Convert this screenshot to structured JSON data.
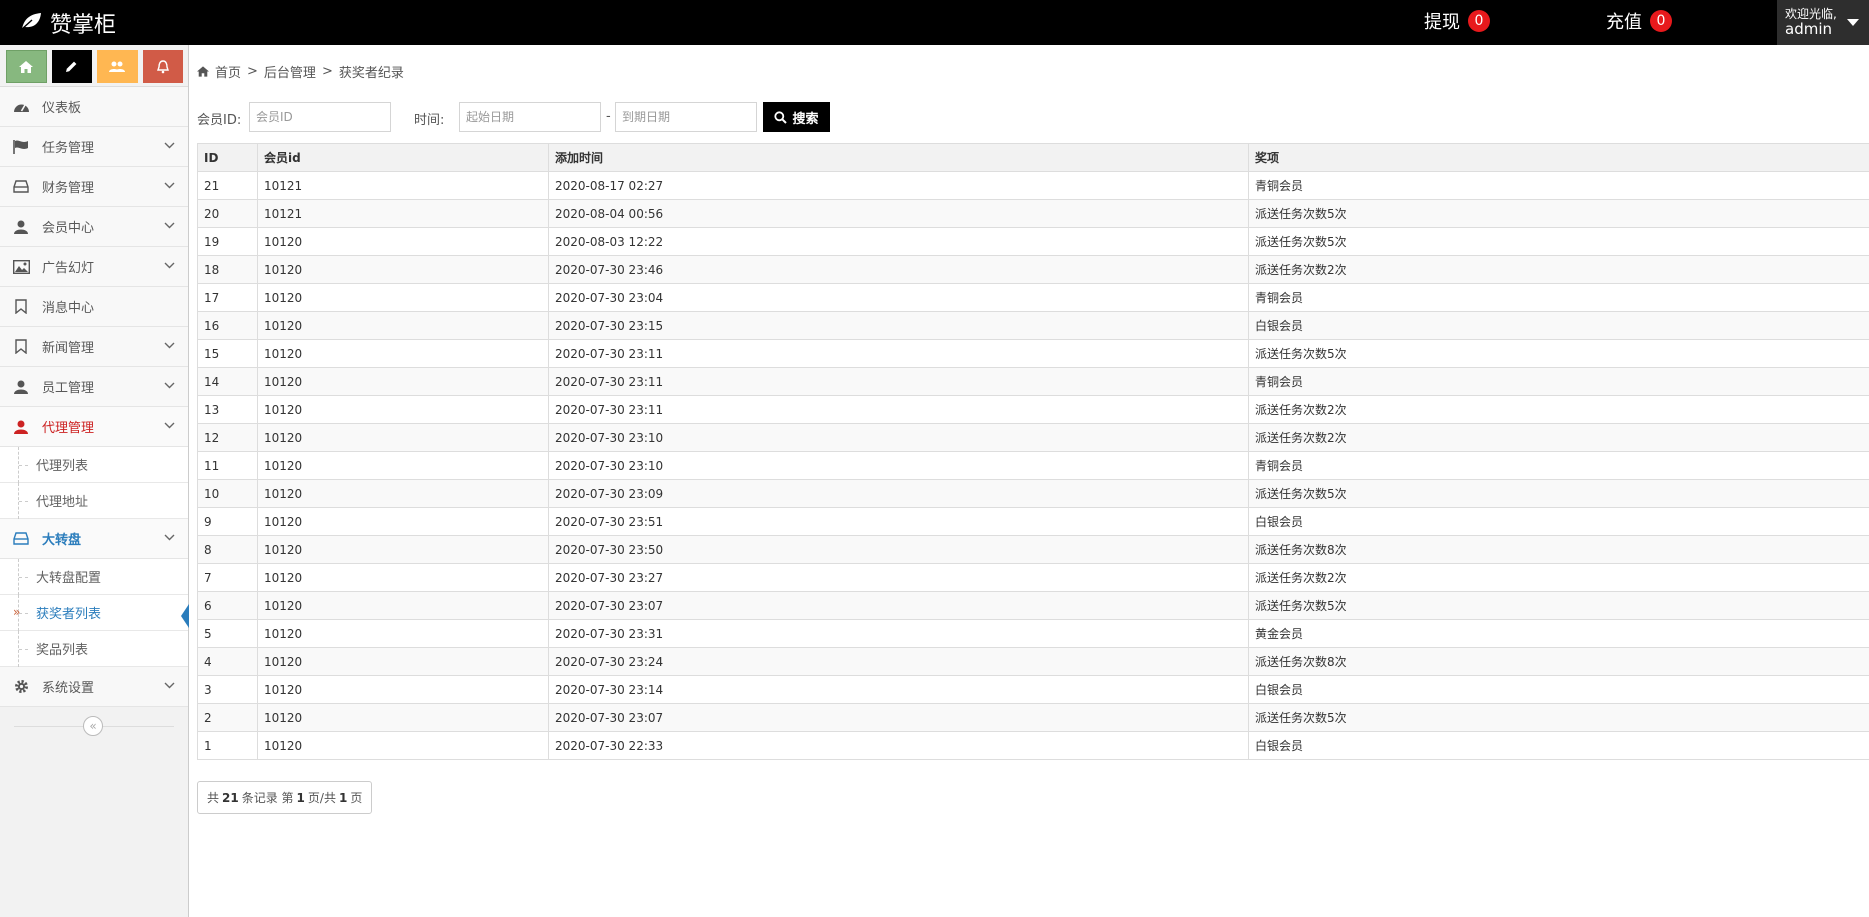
{
  "app": {
    "brand": "赞掌柜"
  },
  "navbar": {
    "withdraw_label": "提现",
    "withdraw_count": "0",
    "recharge_label": "充值",
    "recharge_count": "0",
    "welcome": "欢迎光临,",
    "username": "admin"
  },
  "shortcuts": [
    "home-icon",
    "pencil-icon",
    "users-icon",
    "bell-icon"
  ],
  "sidebar": {
    "dashboard": "仪表板",
    "tasks": "任务管理",
    "finance": "财务管理",
    "members": "会员中心",
    "ads": "广告幻灯",
    "messages": "消息中心",
    "news": "新闻管理",
    "staff": "员工管理",
    "agents": "代理管理",
    "agent_list": "代理列表",
    "agent_address": "代理地址",
    "wheel": "大转盘",
    "wheel_config": "大转盘配置",
    "winner_list": "获奖者列表",
    "prize_list": "奖品列表",
    "settings": "系统设置",
    "collapse": "«"
  },
  "breadcrumb": {
    "home": "首页",
    "sep": ">",
    "admin": "后台管理",
    "current": "获奖者纪录"
  },
  "search": {
    "member_label": "会员ID:",
    "member_placeholder": "会员ID",
    "time_label": "时间:",
    "start_placeholder": "起始日期",
    "dash": "-",
    "end_placeholder": "到期日期",
    "button": "搜索"
  },
  "table": {
    "headers": [
      "ID",
      "会员id",
      "添加时间",
      "奖项"
    ],
    "rows": [
      [
        "21",
        "10121",
        "2020-08-17 02:27",
        "青铜会员"
      ],
      [
        "20",
        "10121",
        "2020-08-04 00:56",
        "派送任务次数5次"
      ],
      [
        "19",
        "10120",
        "2020-08-03 12:22",
        "派送任务次数5次"
      ],
      [
        "18",
        "10120",
        "2020-07-30 23:46",
        "派送任务次数2次"
      ],
      [
        "17",
        "10120",
        "2020-07-30 23:04",
        "青铜会员"
      ],
      [
        "16",
        "10120",
        "2020-07-30 23:15",
        "白银会员"
      ],
      [
        "15",
        "10120",
        "2020-07-30 23:11",
        "派送任务次数5次"
      ],
      [
        "14",
        "10120",
        "2020-07-30 23:11",
        "青铜会员"
      ],
      [
        "13",
        "10120",
        "2020-07-30 23:11",
        "派送任务次数2次"
      ],
      [
        "12",
        "10120",
        "2020-07-30 23:10",
        "派送任务次数2次"
      ],
      [
        "11",
        "10120",
        "2020-07-30 23:10",
        "青铜会员"
      ],
      [
        "10",
        "10120",
        "2020-07-30 23:09",
        "派送任务次数5次"
      ],
      [
        "9",
        "10120",
        "2020-07-30 23:51",
        "白银会员"
      ],
      [
        "8",
        "10120",
        "2020-07-30 23:50",
        "派送任务次数8次"
      ],
      [
        "7",
        "10120",
        "2020-07-30 23:27",
        "派送任务次数2次"
      ],
      [
        "6",
        "10120",
        "2020-07-30 23:07",
        "派送任务次数5次"
      ],
      [
        "5",
        "10120",
        "2020-07-30 23:31",
        "黄金会员"
      ],
      [
        "4",
        "10120",
        "2020-07-30 23:24",
        "派送任务次数8次"
      ],
      [
        "3",
        "10120",
        "2020-07-30 23:14",
        "白银会员"
      ],
      [
        "2",
        "10120",
        "2020-07-30 23:07",
        "派送任务次数5次"
      ],
      [
        "1",
        "10120",
        "2020-07-30 22:33",
        "白银会员"
      ]
    ]
  },
  "pager": {
    "p1": "共",
    "total": "21",
    "p2": "条记录 第",
    "page": "1",
    "p3": "页/共",
    "pages": "1",
    "p4": "页"
  },
  "colors": {
    "navbar": "#000000",
    "badge": "#e8191c",
    "active_blue": "#2b7dbc",
    "active_red": "#cc2222"
  }
}
